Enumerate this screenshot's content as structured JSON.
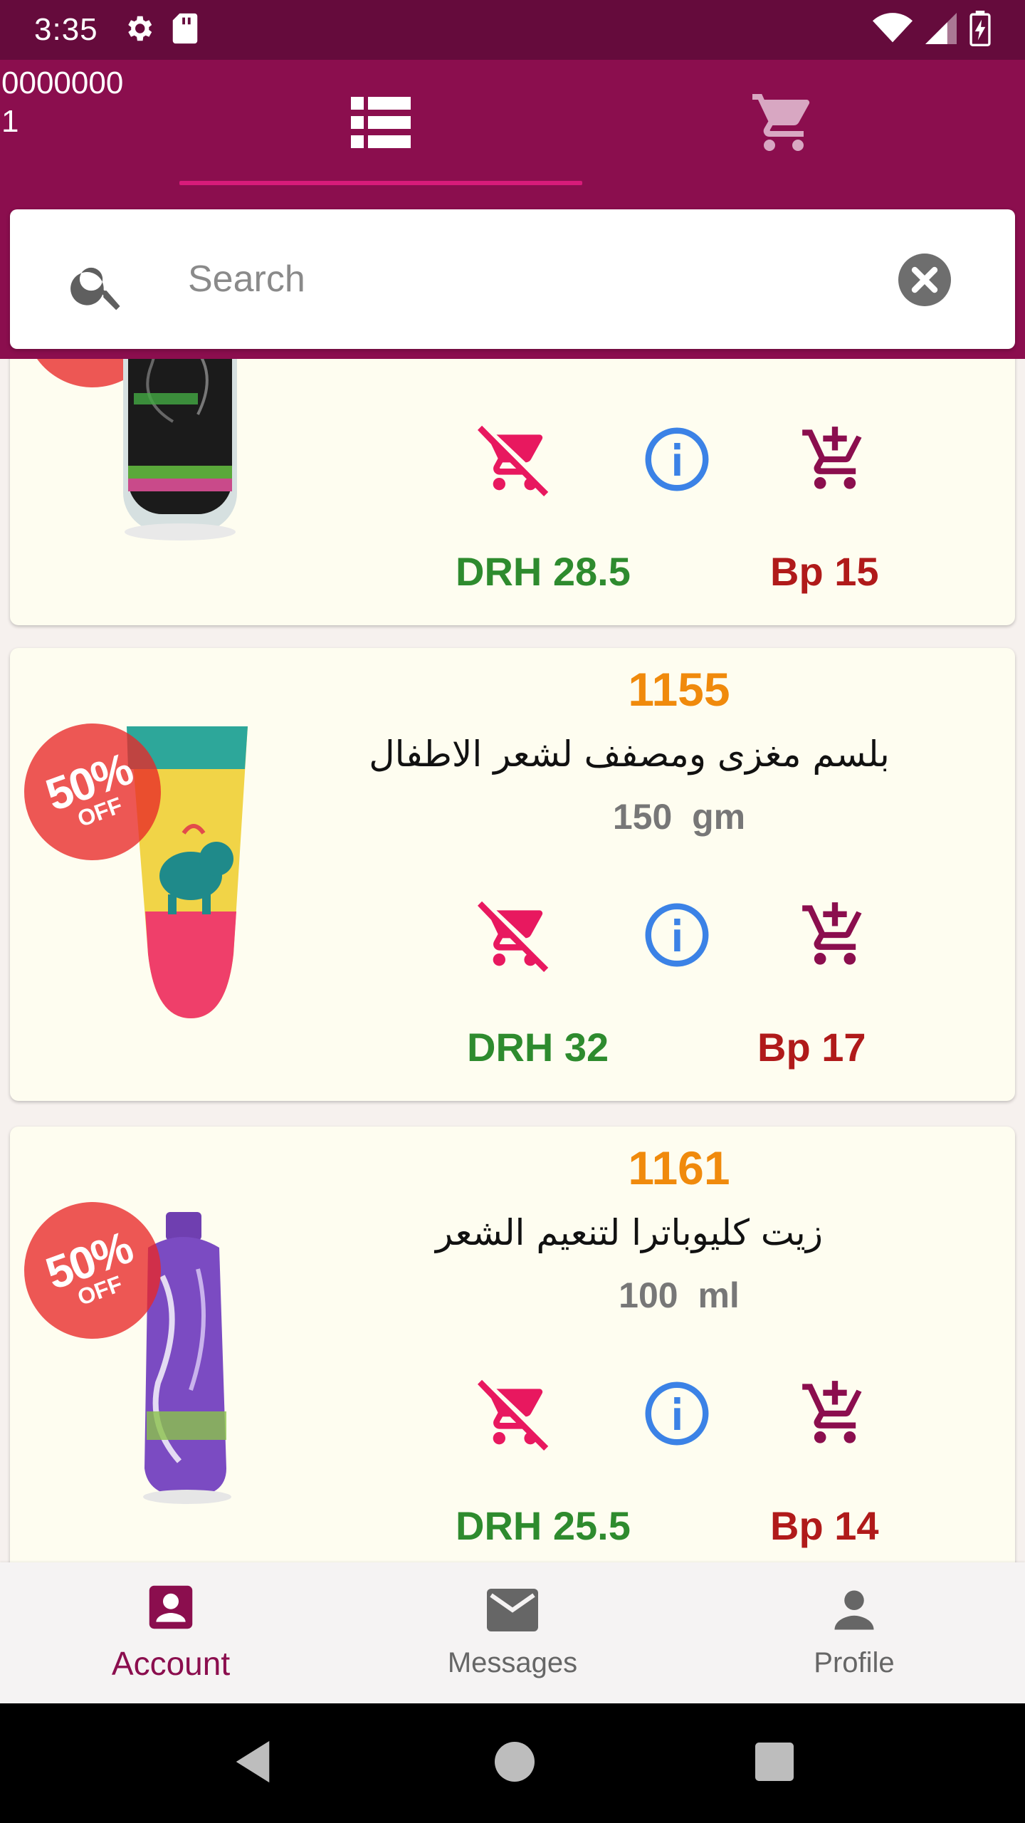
{
  "status_bar": {
    "time": "3:35",
    "icons": [
      "settings-icon",
      "sd-card-icon",
      "wifi-icon",
      "signal-icon",
      "battery-icon"
    ]
  },
  "header": {
    "counter_line1": "0000000",
    "counter_line2": "1",
    "tabs": [
      {
        "name": "list-icon",
        "selected": true
      },
      {
        "name": "cart-icon",
        "selected": false
      }
    ]
  },
  "search": {
    "placeholder": "Search",
    "value": ""
  },
  "products": [
    {
      "code": "",
      "name": "",
      "size": "",
      "price": "DRH 28.5",
      "points": "Bp 15",
      "discount": "",
      "discount_off": ""
    },
    {
      "code": "1155",
      "name": "بلسم مغزى ومصفف لشعر الاطفال",
      "size": "150  gm",
      "price": "DRH 32",
      "points": "Bp 17",
      "discount": "50%",
      "discount_off": "OFF"
    },
    {
      "code": "1161",
      "name": "زيت كليوباترا لتنعيم الشعر",
      "size": "100  ml",
      "price": "DRH 25.5",
      "points": "Bp 14",
      "discount": "50%",
      "discount_off": "OFF"
    }
  ],
  "bottom_nav": {
    "items": [
      {
        "label": "Account",
        "icon": "account-box-icon",
        "active": true
      },
      {
        "label": "Messages",
        "icon": "mail-icon",
        "active": false
      },
      {
        "label": "Profile",
        "icon": "person-icon",
        "active": false
      }
    ]
  },
  "colors": {
    "primary": "#8b0e4e",
    "status_bar": "#650b3c",
    "accent_indicator": "#d81b7a",
    "code": "#f08a0c",
    "price": "#2e8b2e",
    "points": "#b01a1a",
    "remove_cart": "#e8185f",
    "info": "#3b82e6",
    "add_cart": "#8b0e4e"
  }
}
